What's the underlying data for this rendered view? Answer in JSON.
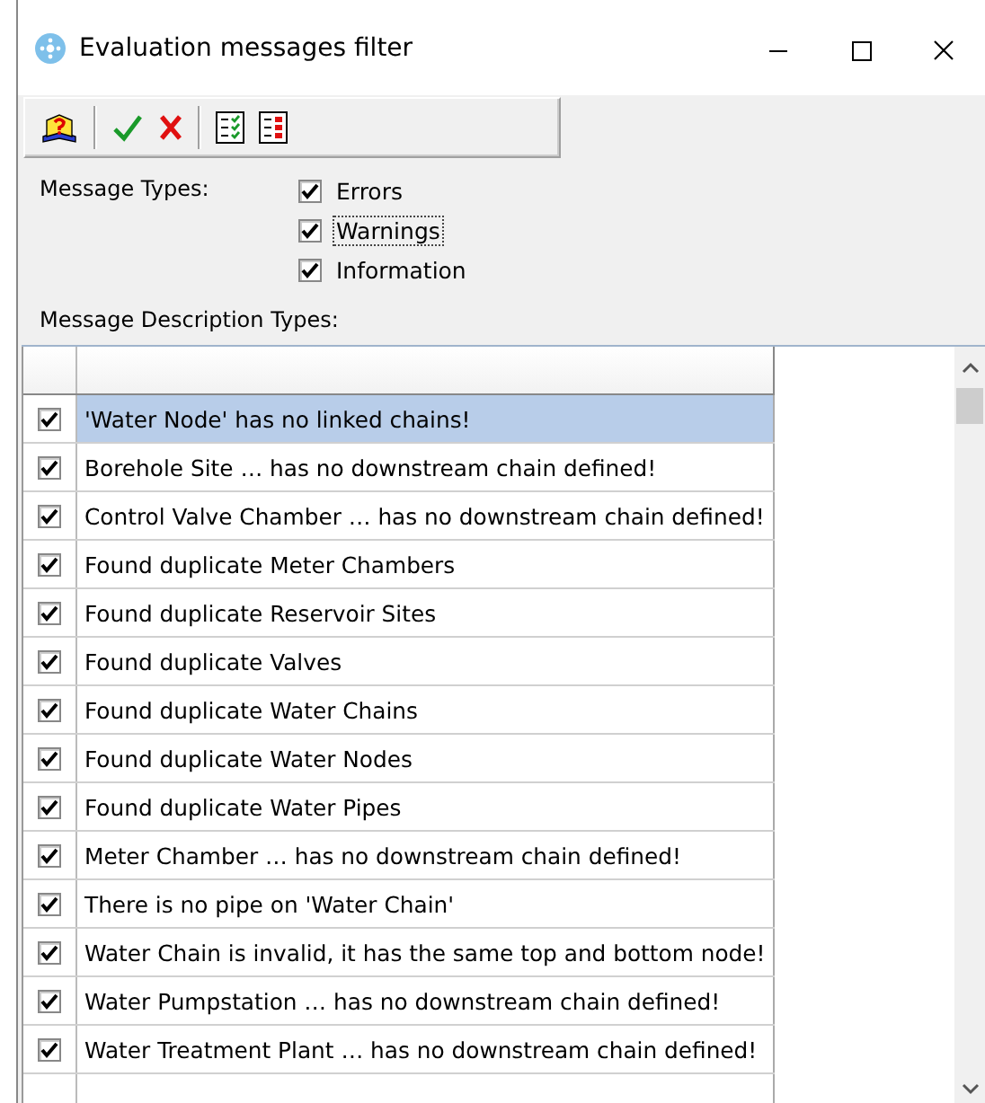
{
  "window": {
    "title": "Evaluation messages filter"
  },
  "toolbar": [
    {
      "kind": "help"
    },
    {
      "kind": "sep"
    },
    {
      "kind": "accept"
    },
    {
      "kind": "cancel"
    },
    {
      "kind": "sep"
    },
    {
      "kind": "check-all"
    },
    {
      "kind": "uncheck-all"
    }
  ],
  "message_types": {
    "label": "Message Types:",
    "options": [
      {
        "label": "Errors",
        "checked": true,
        "focused": false
      },
      {
        "label": "Warnings",
        "checked": true,
        "focused": true
      },
      {
        "label": "Information",
        "checked": true,
        "focused": false
      }
    ]
  },
  "description_types": {
    "label": "Message Description Types:",
    "rows": [
      {
        "text": "'Water Node' has no linked chains!",
        "checked": true,
        "selected": true
      },
      {
        "text": "Borehole Site … has no downstream chain defined!",
        "checked": true,
        "selected": false
      },
      {
        "text": "Control Valve Chamber … has no downstream chain defined!",
        "checked": true,
        "selected": false
      },
      {
        "text": "Found duplicate Meter Chambers",
        "checked": true,
        "selected": false
      },
      {
        "text": "Found duplicate Reservoir Sites",
        "checked": true,
        "selected": false
      },
      {
        "text": "Found duplicate Valves",
        "checked": true,
        "selected": false
      },
      {
        "text": "Found duplicate Water Chains",
        "checked": true,
        "selected": false
      },
      {
        "text": "Found duplicate Water Nodes",
        "checked": true,
        "selected": false
      },
      {
        "text": "Found duplicate Water Pipes",
        "checked": true,
        "selected": false
      },
      {
        "text": "Meter Chamber … has no downstream chain defined!",
        "checked": true,
        "selected": false
      },
      {
        "text": "There is no pipe on 'Water Chain'",
        "checked": true,
        "selected": false
      },
      {
        "text": "Water Chain is invalid, it has the same top and bottom node!",
        "checked": true,
        "selected": false
      },
      {
        "text": "Water Pumpstation … has no downstream chain defined!",
        "checked": true,
        "selected": false
      },
      {
        "text": "Water Treatment Plant … has no downstream chain defined!",
        "checked": true,
        "selected": false
      }
    ]
  }
}
